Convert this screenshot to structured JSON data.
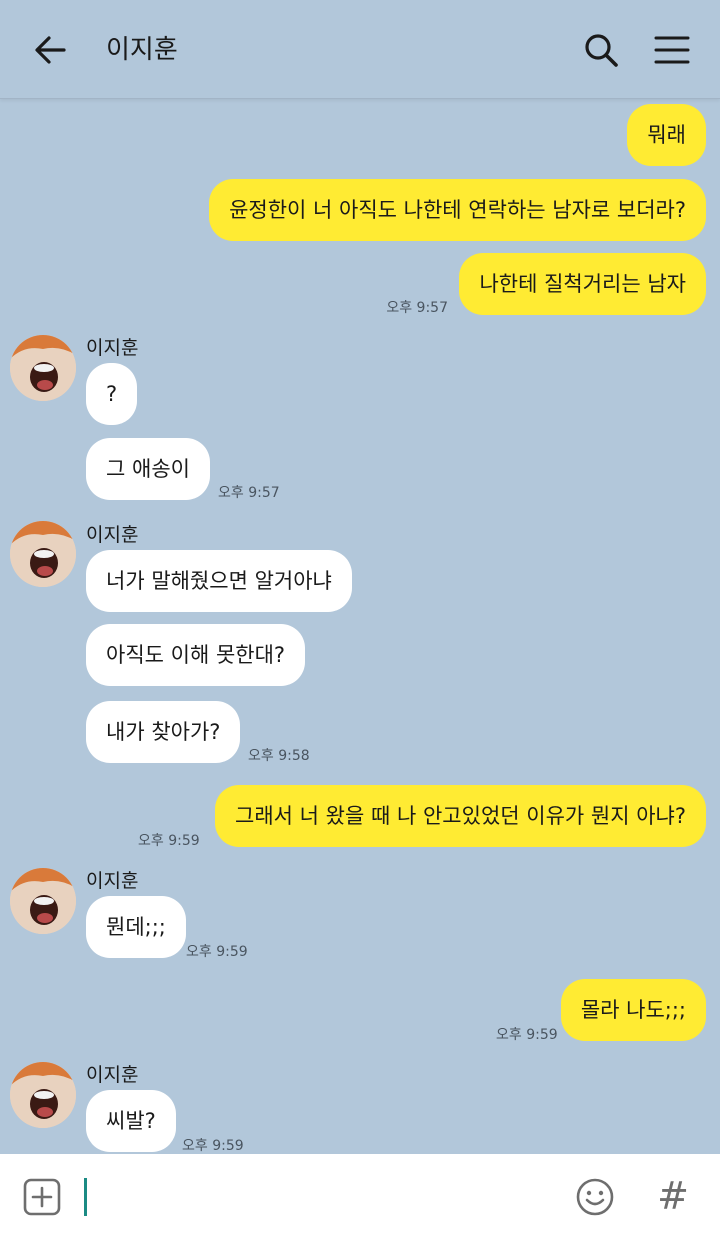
{
  "header": {
    "title": "이지훈",
    "back_icon": "arrow-left-icon",
    "search_icon": "search-icon",
    "menu_icon": "hamburger-menu-icon"
  },
  "colors": {
    "background": "#b2c7da",
    "my_bubble": "#ffeb33",
    "their_bubble": "#ffffff",
    "cursor": "#1b8b84"
  },
  "messages": [
    {
      "side": "me",
      "text": "뭐래"
    },
    {
      "side": "me",
      "text": "윤정한이 너 아직도 나한테 연락하는 남자로 보더라?"
    },
    {
      "side": "me",
      "text": "나한테 질척거리는 남자",
      "time": "오후 9:57"
    },
    {
      "side": "them",
      "sender": "이지훈",
      "text": "?"
    },
    {
      "side": "them",
      "text": "그 애송이",
      "time": "오후 9:57"
    },
    {
      "side": "them",
      "sender": "이지훈",
      "text": "너가 말해줬으면 알거아냐"
    },
    {
      "side": "them",
      "text": "아직도 이해 못한대?"
    },
    {
      "side": "them",
      "text": "내가 찾아가?",
      "time": "오후 9:58"
    },
    {
      "side": "me",
      "text": "그래서 너 왔을 때 나 안고있었던 이유가 뭔지 아냐?",
      "time": "오후 9:59"
    },
    {
      "side": "them",
      "sender": "이지훈",
      "text": "뭔데;;;",
      "time": "오후 9:59"
    },
    {
      "side": "me",
      "text": "몰라 나도;;;",
      "time": "오후 9:59"
    },
    {
      "side": "them",
      "sender": "이지훈",
      "text": "씨발?",
      "time": "오후 9:59"
    }
  ],
  "input": {
    "placeholder": "",
    "plus_icon": "plus-square-icon",
    "emoji_icon": "smiley-icon",
    "hash_label": "#"
  }
}
